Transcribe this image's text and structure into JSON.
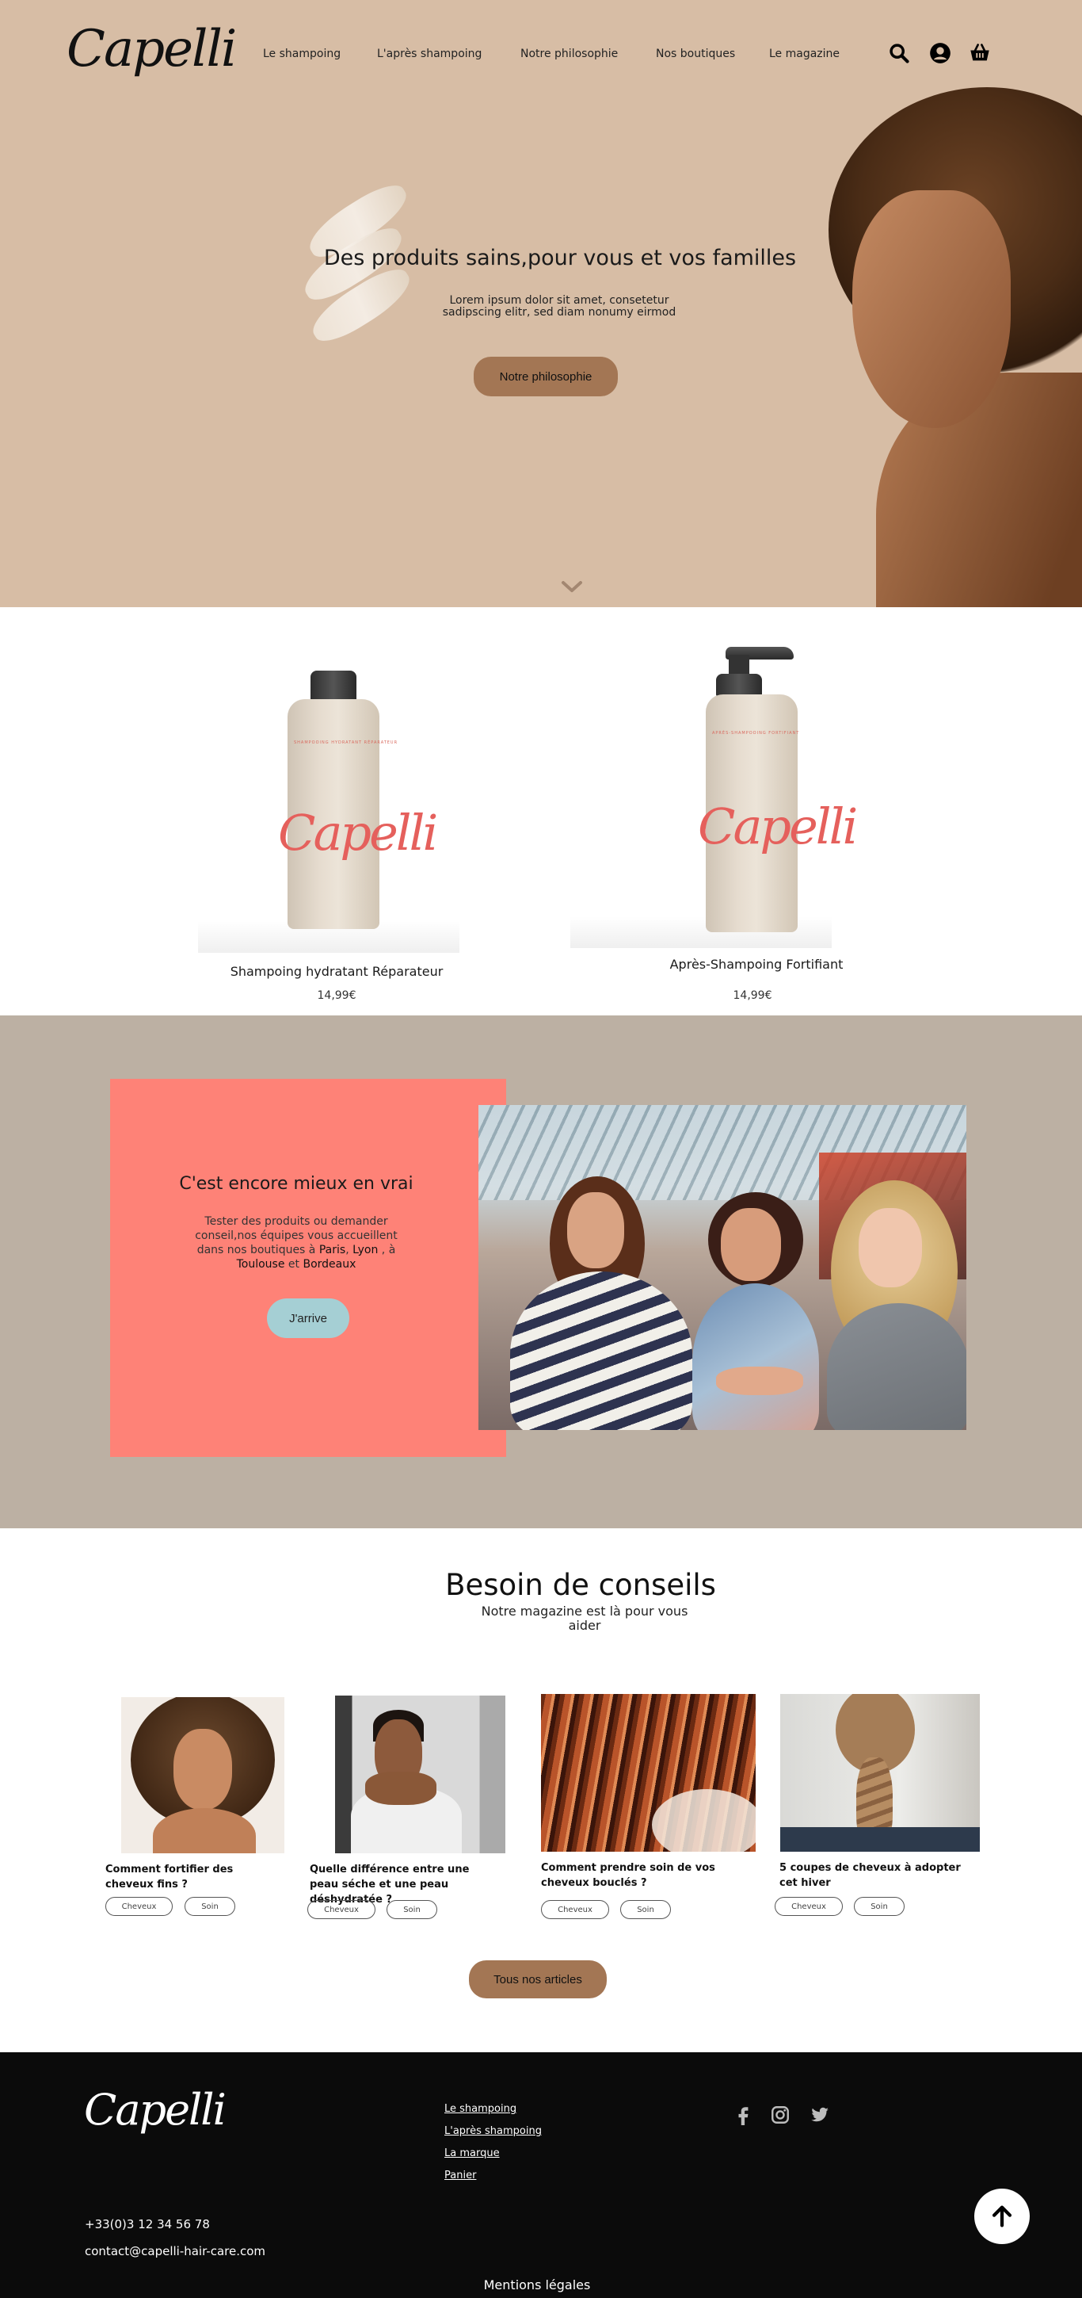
{
  "brand": {
    "logo_text": "Capelli"
  },
  "nav": {
    "items": [
      {
        "label": "Le shampoing"
      },
      {
        "label": "L'après shampoing"
      },
      {
        "label": "Notre philosophie"
      },
      {
        "label": "Nos boutiques"
      },
      {
        "label": "Le magazine"
      }
    ],
    "icons": [
      "search-icon",
      "user-icon",
      "basket-icon"
    ]
  },
  "hero": {
    "title": "Des produits sains,pour vous et vos familles",
    "text": "Lorem ipsum dolor sit amet, consetetur sadipscing elitr, sed diam nonumy eirmod",
    "button_label": "Notre philosophie"
  },
  "products": [
    {
      "name": "Shampoing hydratant Réparateur",
      "price": "14,99€",
      "bottle_brand": "Capelli",
      "bottle_label": "SHAMPOOING HYDRATANT RÉPARATEUR"
    },
    {
      "name": "Après-Shampoing Fortifiant",
      "price": "14,99€",
      "bottle_brand": "Capelli",
      "bottle_label": "APRÈS-SHAMPOOING FORTIFIANT"
    }
  ],
  "store": {
    "title": "C'est encore mieux en vrai",
    "text_intro": "Tester des produits ou demander conseil,nos équipes vous accueillent dans nos boutiques à ",
    "city_1": "Paris",
    "sep_1": ", ",
    "city_2": "Lyon",
    "sep_2": " , à ",
    "city_3": "Toulouse",
    "sep_3": " et ",
    "city_4": "Bordeaux",
    "button_label": "J'arrive"
  },
  "advice": {
    "title": "Besoin de conseils",
    "subtitle": "Notre magazine est là pour vous aider",
    "articles": [
      {
        "title": "Comment fortifier des cheveux fins ?",
        "tags": [
          "Cheveux",
          "Soin"
        ]
      },
      {
        "title": "Quelle différence entre une peau séche et une peau déshydratée ?",
        "tags": [
          "Cheveux",
          "Soin"
        ]
      },
      {
        "title": "Comment prendre soin de vos cheveux bouclés ?",
        "tags": [
          "Cheveux",
          "Soin"
        ]
      },
      {
        "title": "5 coupes de cheveux à adopter cet hiver",
        "tags": [
          "Cheveux",
          "Soin"
        ]
      }
    ],
    "button_label": "Tous nos articles"
  },
  "footer": {
    "logo_text": "Capelli",
    "links": [
      {
        "label": "Le shampoing"
      },
      {
        "label": "L'après shampoing"
      },
      {
        "label": "La marque"
      },
      {
        "label": "Panier"
      }
    ],
    "social": [
      "facebook-icon",
      "instagram-icon",
      "twitter-icon"
    ],
    "phone": "+33(0)3 12 34 56 78",
    "email": "contact@capelli-hair-care.com",
    "legal": "Mentions légales"
  },
  "colors": {
    "hero_bg": "#d7bda5",
    "accent_brown": "#a37654",
    "store_bg": "#bcb0a3",
    "coral": "#fe8277",
    "button_blue": "#a5cfd4",
    "footer_bg": "#0b0b0b"
  }
}
